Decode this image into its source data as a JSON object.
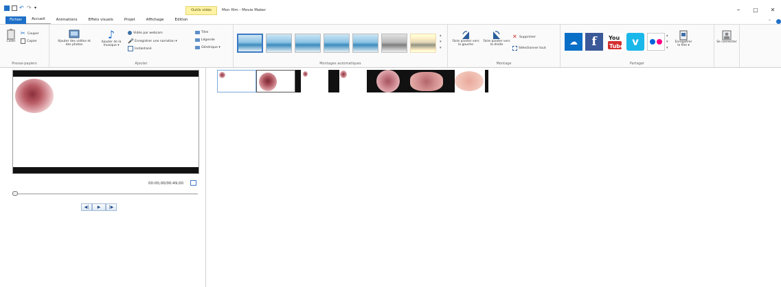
{
  "window": {
    "context_tab": "Outils vidéo",
    "title": "Mon film - Movie Maker",
    "controls": {
      "minimize": "–",
      "restore": "□",
      "close": "✕"
    }
  },
  "tabs": [
    {
      "label": "Fichier"
    },
    {
      "label": "Accueil"
    },
    {
      "label": "Animations"
    },
    {
      "label": "Effets visuels"
    },
    {
      "label": "Projet"
    },
    {
      "label": "Affichage"
    },
    {
      "label": "Edition"
    }
  ],
  "ribbon": {
    "clipboard": {
      "label": "Presse-papiers",
      "paste": "Coller",
      "cut": "Couper",
      "copy": "Copier"
    },
    "add": {
      "label": "Ajouter",
      "add_videos": "Ajouter des vidéos et des photos",
      "add_music": "Ajouter de la musique ▾",
      "webcam": "Vidéo par webcam",
      "narration": "Enregistrer une narration ▾",
      "snapshot": "Instantané",
      "title": "Titre",
      "caption": "Légende",
      "credits": "Générique ▾"
    },
    "automovie": {
      "label": "Montages automatiques"
    },
    "editing": {
      "label": "Montage",
      "rotate_left": "Faire pivoter vers la gauche",
      "rotate_right": "Faire pivoter vers la droite",
      "delete": "Supprimer",
      "select_all": "Sélectionner tout"
    },
    "share": {
      "label": "Partager",
      "save_movie": "Enregistrer le film ▾",
      "sign_in": "Se connecter"
    }
  },
  "preview": {
    "timecode": "00:00,00/00:49,00"
  },
  "colors": {
    "accent": "#1e6fc8",
    "file_tab": "#1e6fc8",
    "context_tab": "#fff3a6"
  }
}
